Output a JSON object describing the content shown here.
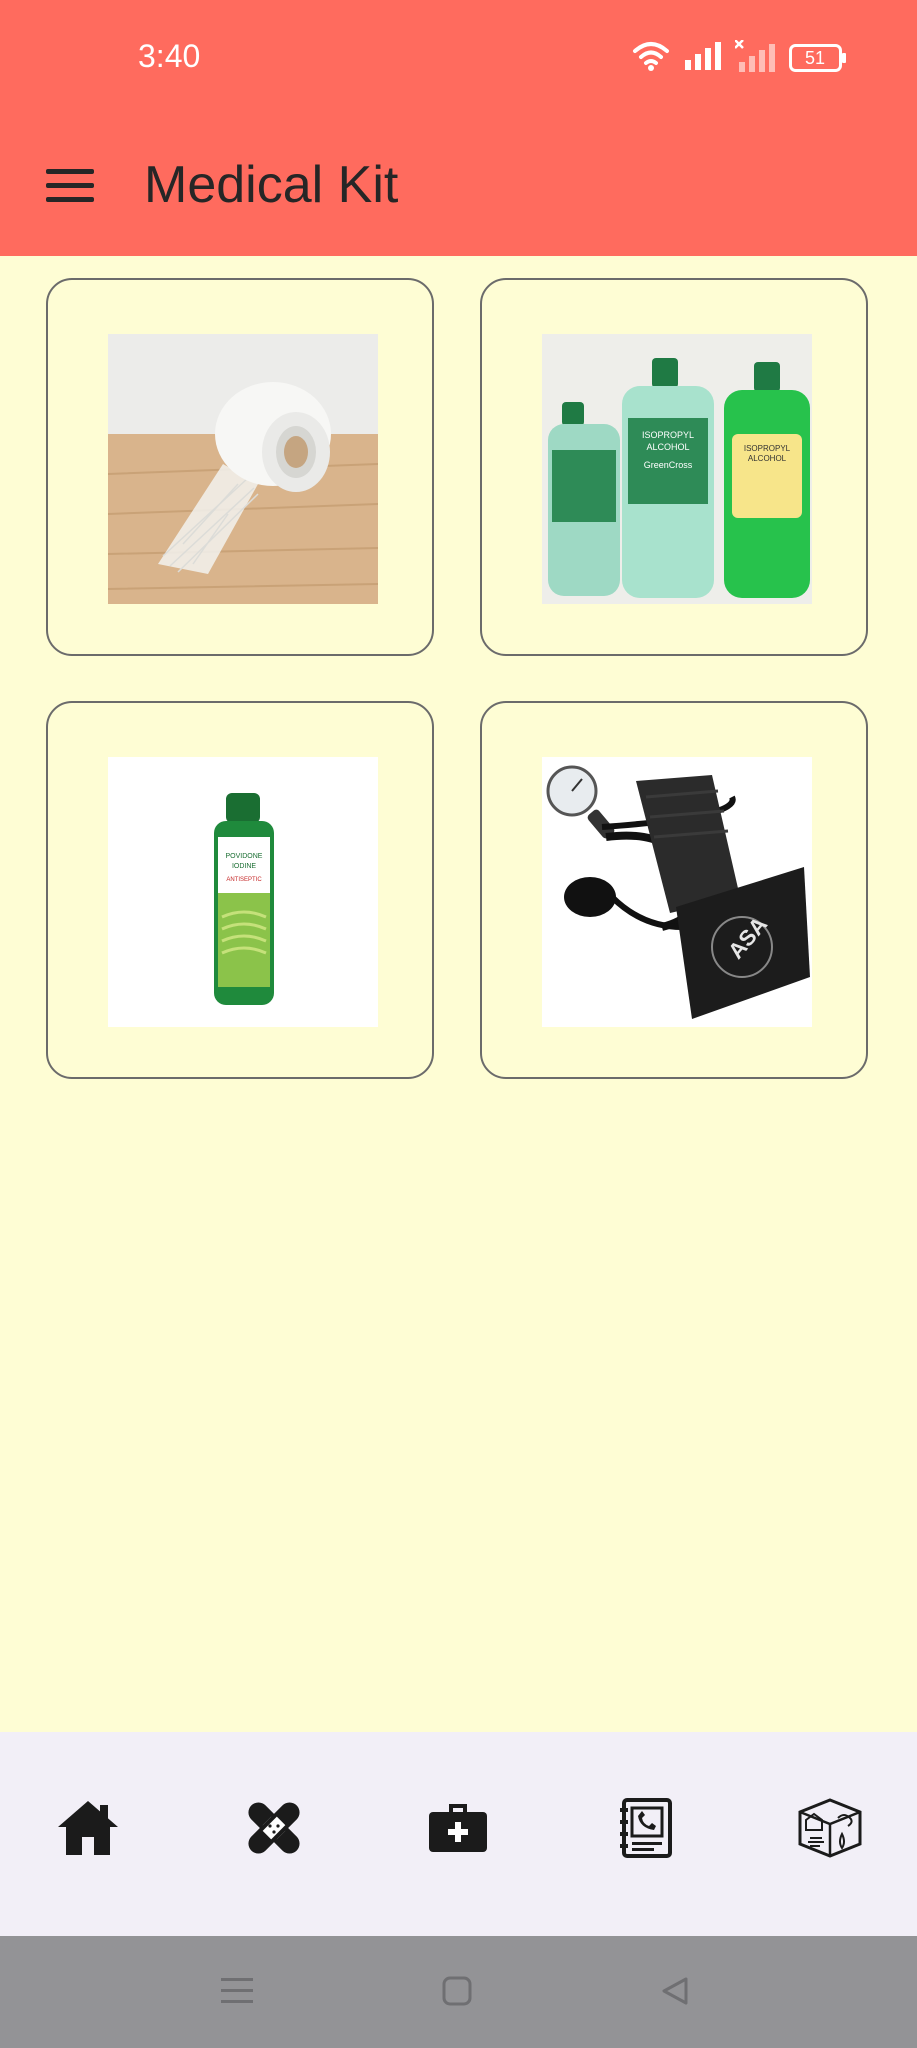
{
  "status_bar": {
    "time": "3:40",
    "battery": "51",
    "icons": [
      "wifi-icon",
      "signal-icon",
      "signal-no-service-icon",
      "battery-icon"
    ]
  },
  "app_bar": {
    "title": "Medical Kit",
    "menu_icon": "hamburger-menu-icon"
  },
  "items": [
    {
      "name": "medical-tape",
      "image": "Roll of white mesh medical tape"
    },
    {
      "name": "isopropyl-alcohol",
      "image": "Three green bottles of isopropyl alcohol"
    },
    {
      "name": "povidone-iodine",
      "image": "Green bottle of povidone iodine antiseptic"
    },
    {
      "name": "blood-pressure-monitor",
      "image": "Sphygmomanometer with black cuff and gauge"
    }
  ],
  "image_text": {
    "alcohol_label_1": "ISOPROPYL",
    "alcohol_label_2": "ALCOHOL",
    "alcohol_brand": "GreenCross",
    "iodine_label_1": "POVIDONE",
    "iodine_label_2": "IODINE",
    "iodine_label_3": "ANTISEPTIC",
    "cuff_brand": "ASA"
  },
  "bottom_nav": {
    "items": [
      {
        "icon": "home-icon"
      },
      {
        "icon": "bandage-icon"
      },
      {
        "icon": "medical-kit-icon",
        "active": true
      },
      {
        "icon": "phone-directory-icon"
      },
      {
        "icon": "emergency-guide-icon"
      }
    ]
  },
  "system_nav": {
    "icons": [
      "recents-icon",
      "home-square-icon",
      "back-icon"
    ]
  },
  "colors": {
    "app_bar": "#FF6B5E",
    "background": "#FEFDD4",
    "bottom_nav": "#F2EFF7",
    "system_nav": "#939396"
  }
}
